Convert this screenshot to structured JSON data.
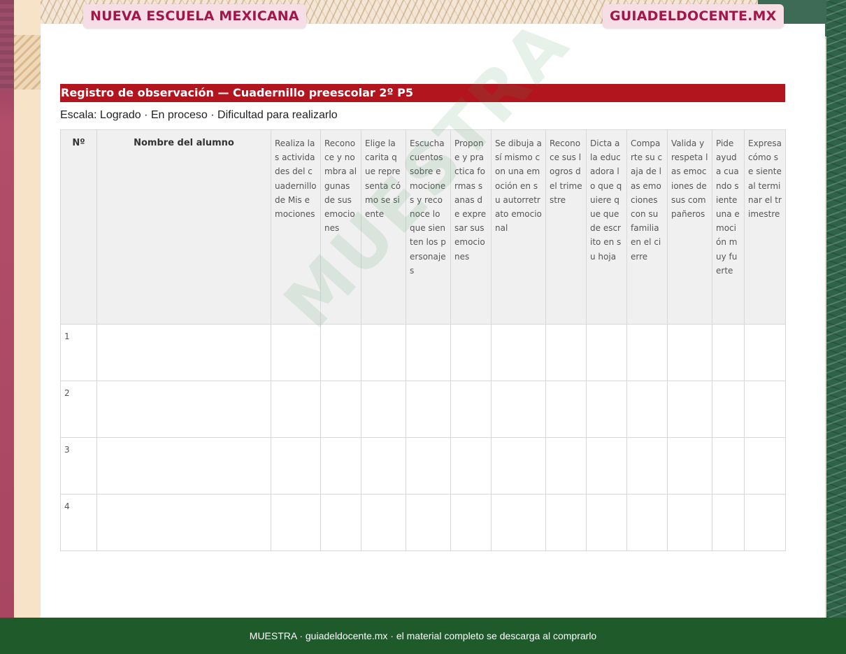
{
  "header": {
    "left_badge": "NUEVA ESCUELA MEXICANA",
    "right_badge": "GUIADELDOCENTE.MX"
  },
  "document": {
    "title": "Registro de observación — Cuadernillo preescolar 2º P5",
    "scale": "Escala: Logrado · En proceso · Dificultad para realizarlo"
  },
  "table": {
    "number_header": "Nº",
    "name_header": "Nombre del alumno",
    "criteria": [
      "Realiza las actividades del cuadernillo de Mis emociones",
      "Reconoce y nombra algunas de sus emociones",
      "Elige la carita que representa cómo se siente",
      "Escucha cuentos sobre emociones y reconoce lo que sienten los personajes",
      "Propone y practica formas sanas de expresar sus emociones",
      "Se dibuja a sí mismo con una emoción en su autorretrato emocional",
      "Reconoce sus logros del trimestre",
      "Dicta a la educadora lo que quiere que quede escrito en su hoja",
      "Comparte su caja de las emociones con su familia en el cierre",
      "Valida y respeta las emociones de sus compañeros",
      "Pide ayuda cuando siente una emoción muy fuerte",
      "Expresa cómo se siente al terminar el trimestre"
    ],
    "rows": [
      "1",
      "2",
      "3",
      "4"
    ]
  },
  "watermark": "MUESTRA",
  "footer": "MUESTRA · guiadeldocente.mx · el material completo se descarga al comprarlo",
  "colors": {
    "title_bar": "#b3151e",
    "badge_text": "#a01848",
    "badge_bg": "#f6dde6",
    "footer_bg": "#1f5a2b",
    "header_cell_bg": "#f0f0f0"
  }
}
